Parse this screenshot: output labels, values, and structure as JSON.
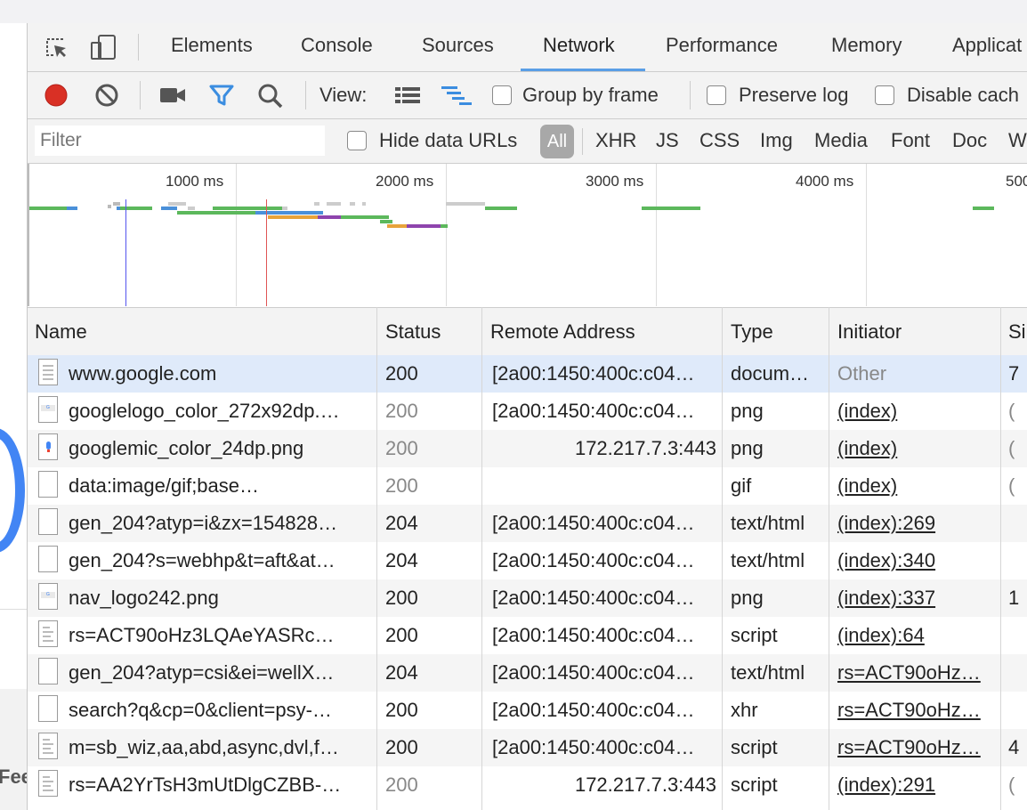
{
  "background": {
    "partial_text": "Fee"
  },
  "tabs": [
    {
      "label": "Elements"
    },
    {
      "label": "Console"
    },
    {
      "label": "Sources"
    },
    {
      "label": "Network",
      "active": true
    },
    {
      "label": "Performance"
    },
    {
      "label": "Memory"
    },
    {
      "label": "Applicat"
    }
  ],
  "toolbar": {
    "view_label": "View:",
    "group_by_frame": {
      "label": "Group by frame",
      "checked": false
    },
    "preserve_log": {
      "label": "Preserve log",
      "checked": false
    },
    "disable_cache": {
      "label": "Disable cach",
      "checked": false
    }
  },
  "filter": {
    "placeholder": "Filter",
    "hide_data_urls": {
      "label": "Hide data URLs",
      "checked": false
    },
    "types": [
      "All",
      "XHR",
      "JS",
      "CSS",
      "Img",
      "Media",
      "Font",
      "Doc",
      "W"
    ],
    "active_type": "All"
  },
  "overview": {
    "ticks": [
      "1000 ms",
      "2000 ms",
      "3000 ms",
      "4000 ms",
      "500"
    ]
  },
  "colors": {
    "record": "#d93025",
    "accent": "#5a9ee6",
    "selected_row": "#dfeafa",
    "dom_content_loaded": "#5555ee",
    "load": "#e05555"
  },
  "table": {
    "columns": [
      "Name",
      "Status",
      "Remote Address",
      "Type",
      "Initiator",
      "Si"
    ],
    "rows": [
      {
        "icon": "document-icon",
        "name": "www.google.com",
        "status": "200",
        "status_dim": false,
        "address": "[2a00:1450:400c:c04…",
        "address_align": "left",
        "type": "docum…",
        "initiator": "Other",
        "init_link": false,
        "init_dim": true,
        "size": "7",
        "size_dim": false
      },
      {
        "icon": "image-thumb-icon",
        "name": "googlelogo_color_272x92dp.…",
        "status": "200",
        "status_dim": true,
        "address": "[2a00:1450:400c:c04…",
        "address_align": "left",
        "type": "png",
        "initiator": "(index)",
        "init_link": true,
        "init_dim": false,
        "size": "(",
        "size_dim": true
      },
      {
        "icon": "mic-image-icon",
        "name": "googlemic_color_24dp.png",
        "status": "200",
        "status_dim": true,
        "address": "172.217.7.3:443",
        "address_align": "right",
        "type": "png",
        "initiator": "(index)",
        "init_link": true,
        "init_dim": false,
        "size": "(",
        "size_dim": true
      },
      {
        "icon": "file-icon",
        "name": "data:image/gif;base…",
        "status": "200",
        "status_dim": true,
        "address": "",
        "address_align": "left",
        "type": "gif",
        "initiator": "(index)",
        "init_link": true,
        "init_dim": false,
        "size": "(",
        "size_dim": true
      },
      {
        "icon": "file-icon",
        "name": "gen_204?atyp=i&zx=154828…",
        "status": "204",
        "status_dim": false,
        "address": "[2a00:1450:400c:c04…",
        "address_align": "left",
        "type": "text/html",
        "initiator": "(index):269",
        "init_link": true,
        "init_dim": false,
        "size": "",
        "size_dim": false
      },
      {
        "icon": "file-icon",
        "name": "gen_204?s=webhp&t=aft&at…",
        "status": "204",
        "status_dim": false,
        "address": "[2a00:1450:400c:c04…",
        "address_align": "left",
        "type": "text/html",
        "initiator": "(index):340",
        "init_link": true,
        "init_dim": false,
        "size": "",
        "size_dim": false
      },
      {
        "icon": "image-thumb-icon",
        "name": "nav_logo242.png",
        "status": "200",
        "status_dim": false,
        "address": "[2a00:1450:400c:c04…",
        "address_align": "left",
        "type": "png",
        "initiator": "(index):337",
        "init_link": true,
        "init_dim": false,
        "size": "1",
        "size_dim": false
      },
      {
        "icon": "script-icon",
        "name": "rs=ACT90oHz3LQAeYASRc…",
        "status": "200",
        "status_dim": false,
        "address": "[2a00:1450:400c:c04…",
        "address_align": "left",
        "type": "script",
        "initiator": "(index):64",
        "init_link": true,
        "init_dim": false,
        "size": "",
        "size_dim": false
      },
      {
        "icon": "file-icon",
        "name": "gen_204?atyp=csi&ei=wellX…",
        "status": "204",
        "status_dim": false,
        "address": "[2a00:1450:400c:c04…",
        "address_align": "left",
        "type": "text/html",
        "initiator": "rs=ACT90oHz…",
        "init_link": true,
        "init_dim": false,
        "size": "",
        "size_dim": false
      },
      {
        "icon": "file-icon",
        "name": "search?q&cp=0&client=psy-…",
        "status": "200",
        "status_dim": false,
        "address": "[2a00:1450:400c:c04…",
        "address_align": "left",
        "type": "xhr",
        "initiator": "rs=ACT90oHz…",
        "init_link": true,
        "init_dim": false,
        "size": "",
        "size_dim": false
      },
      {
        "icon": "script-icon",
        "name": "m=sb_wiz,aa,abd,async,dvl,f…",
        "status": "200",
        "status_dim": false,
        "address": "[2a00:1450:400c:c04…",
        "address_align": "left",
        "type": "script",
        "initiator": "rs=ACT90oHz…",
        "init_link": true,
        "init_dim": false,
        "size": "4",
        "size_dim": false
      },
      {
        "icon": "script-icon",
        "name": "rs=AA2YrTsH3mUtDlgCZBB-…",
        "status": "200",
        "status_dim": true,
        "address": "172.217.7.3:443",
        "address_align": "right",
        "type": "script",
        "initiator": "(index):291",
        "init_link": true,
        "init_dim": false,
        "size": "(",
        "size_dim": true
      }
    ]
  }
}
